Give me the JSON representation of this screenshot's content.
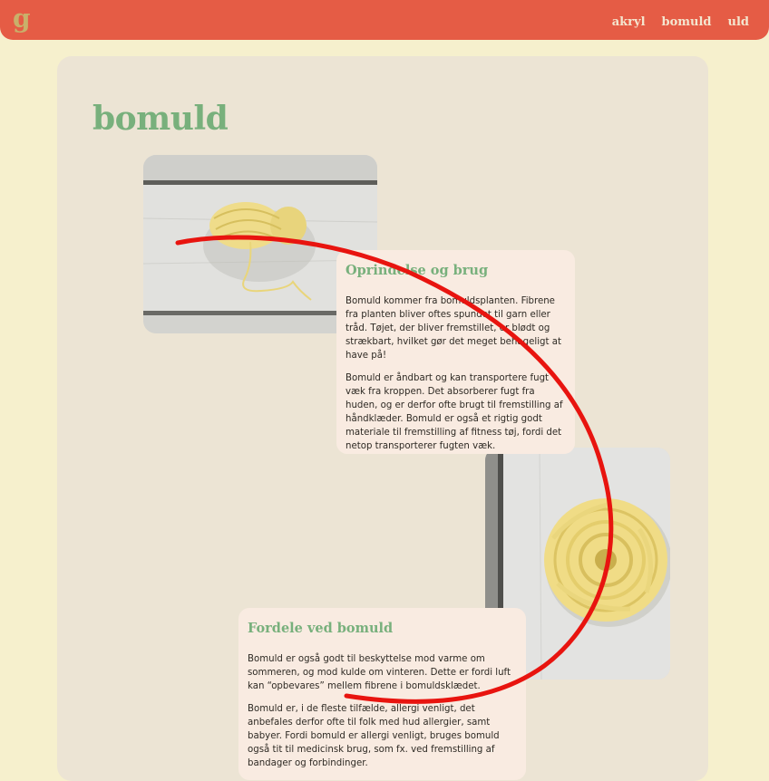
{
  "logo": "g",
  "nav": {
    "items": [
      "akryl",
      "bomuld",
      "uld"
    ]
  },
  "page": {
    "title": "bomuld"
  },
  "sections": [
    {
      "heading": "Oprindelse og brug",
      "paragraphs": [
        "Bomuld kommer fra bomuldsplanten. Fibrene fra planten bliver oftes spundet til garn eller tråd. Tøjet, der bliver fremstillet, er blødt og strækbart, hvilket gør det meget behageligt at have på!",
        "Bomuld er åndbart og kan transportere fugt væk fra kroppen. Det absorberer fugt fra huden, og er derfor ofte brugt til fremstilling af håndklæder. Bomuld er også et rigtig godt materiale til fremstilling af fitness tøj, fordi det netop transporterer fugten væk."
      ]
    },
    {
      "heading": "Fordele ved bomuld",
      "paragraphs": [
        "Bomuld er også godt til beskyttelse mod varme om sommeren, og mod kulde om vinteren. Dette er fordi luft kan “opbevares” mellem fibrene i bomuldsklædet.",
        "Bomuld er, i de fleste tilfælde, allergi venligt, det anbefales derfor ofte til folk med hud allergier, samt babyer. Fordi bomuld er allergi venligt, bruges bomuld også tit til medicinsk brug, som fx. ved fremstilling af bandager og forbindinger."
      ]
    }
  ],
  "colors": {
    "header": "#e55c45",
    "background": "#f6f0cd",
    "panel": "#ece4d4",
    "card": "#f9ebe1",
    "accent_green": "#78b07c",
    "annotation_red": "#e8140f"
  }
}
